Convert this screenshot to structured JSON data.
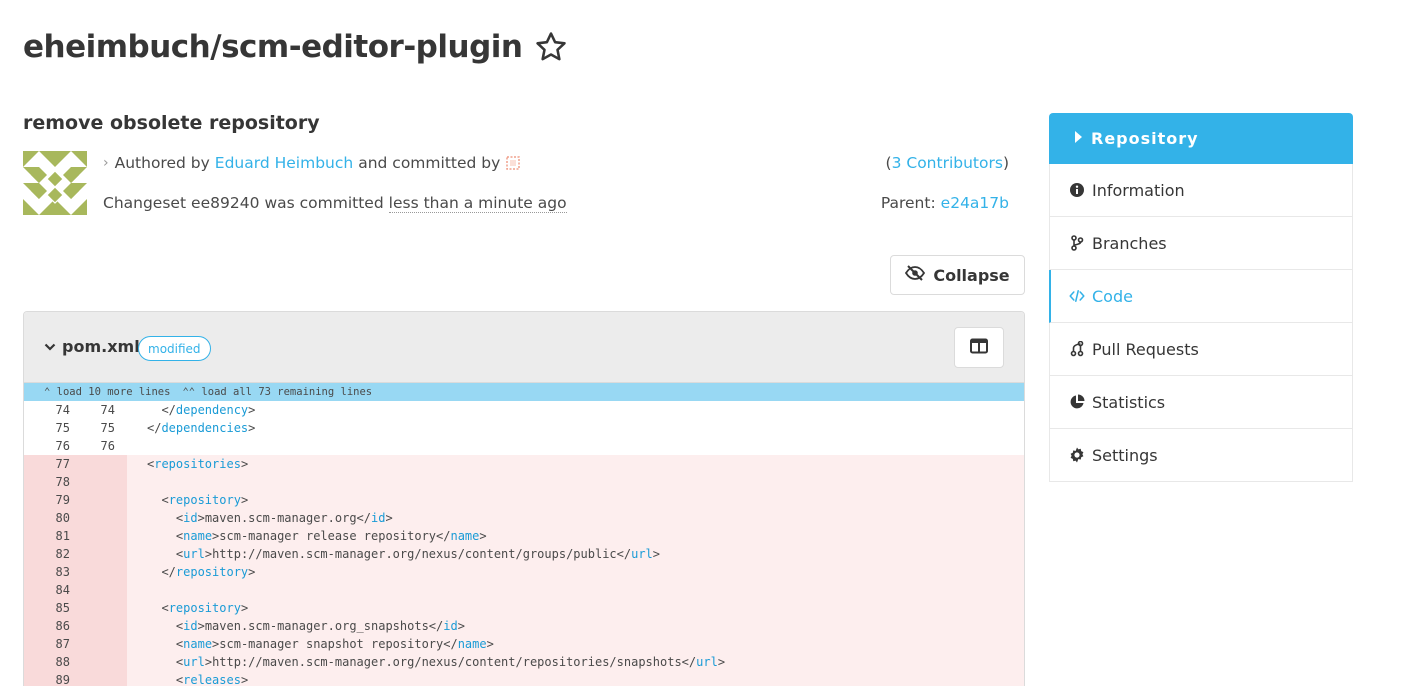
{
  "repo": {
    "title": "eheimbuch/scm-editor-plugin"
  },
  "changeset": {
    "title": "remove obsolete repository",
    "authored_prefix": "Authored by",
    "author": "Eduard Heimbuch",
    "committed_text": "and committed by",
    "line2_prefix": "Changeset",
    "hash": "ee89240",
    "was_committed": "was committed",
    "ago": "less than a minute ago",
    "contributors_open": "(",
    "contributors_link": "3 Contributors",
    "contributors_close": ")",
    "parent_label": "Parent:",
    "parent_hash": "e24a17b"
  },
  "collapse_label": "Collapse",
  "diff": {
    "file_name": "pom.xml",
    "file_tag": "modified",
    "load_more": "load 10 more lines",
    "load_all": "load all 73 remaining lines",
    "lines": [
      {
        "old": "74",
        "new": "74",
        "indent": "  ",
        "open": "</",
        "tag": "dependency",
        "close": ">",
        "rest": "",
        "type": "context"
      },
      {
        "old": "75",
        "new": "75",
        "indent": "",
        "open": "</",
        "tag": "dependencies",
        "close": ">",
        "rest": "",
        "type": "context"
      },
      {
        "old": "76",
        "new": "76",
        "indent": "",
        "open": "",
        "tag": "",
        "close": "",
        "rest": "",
        "type": "context"
      },
      {
        "old": "77",
        "new": "",
        "indent": "",
        "open": "<",
        "tag": "repositories",
        "close": ">",
        "rest": "",
        "type": "del"
      },
      {
        "old": "78",
        "new": "",
        "indent": "",
        "open": "",
        "tag": "",
        "close": "",
        "rest": "",
        "type": "del"
      },
      {
        "old": "79",
        "new": "",
        "indent": "  ",
        "open": "<",
        "tag": "repository",
        "close": ">",
        "rest": "",
        "type": "del"
      },
      {
        "old": "80",
        "new": "",
        "indent": "    ",
        "open": "<",
        "tag": "id",
        "close": ">",
        "rest": "maven.scm-manager.org</",
        "tag2": "id",
        "end": ">",
        "type": "del"
      },
      {
        "old": "81",
        "new": "",
        "indent": "    ",
        "open": "<",
        "tag": "name",
        "close": ">",
        "rest": "scm-manager release repository</",
        "tag2": "name",
        "end": ">",
        "type": "del"
      },
      {
        "old": "82",
        "new": "",
        "indent": "    ",
        "open": "<",
        "tag": "url",
        "close": ">",
        "rest": "http://maven.scm-manager.org/nexus/content/groups/public</",
        "tag2": "url",
        "end": ">",
        "type": "del"
      },
      {
        "old": "83",
        "new": "",
        "indent": "  ",
        "open": "</",
        "tag": "repository",
        "close": ">",
        "rest": "",
        "type": "del"
      },
      {
        "old": "84",
        "new": "",
        "indent": "",
        "open": "",
        "tag": "",
        "close": "",
        "rest": "",
        "type": "del"
      },
      {
        "old": "85",
        "new": "",
        "indent": "  ",
        "open": "<",
        "tag": "repository",
        "close": ">",
        "rest": "",
        "type": "del"
      },
      {
        "old": "86",
        "new": "",
        "indent": "    ",
        "open": "<",
        "tag": "id",
        "close": ">",
        "rest": "maven.scm-manager.org_snapshots</",
        "tag2": "id",
        "end": ">",
        "type": "del"
      },
      {
        "old": "87",
        "new": "",
        "indent": "    ",
        "open": "<",
        "tag": "name",
        "close": ">",
        "rest": "scm-manager snapshot repository</",
        "tag2": "name",
        "end": ">",
        "type": "del"
      },
      {
        "old": "88",
        "new": "",
        "indent": "    ",
        "open": "<",
        "tag": "url",
        "close": ">",
        "rest": "http://maven.scm-manager.org/nexus/content/repositories/snapshots</",
        "tag2": "url",
        "end": ">",
        "type": "del"
      },
      {
        "old": "89",
        "new": "",
        "indent": "    ",
        "open": "<",
        "tag": "releases",
        "close": ">",
        "rest": "",
        "type": "del"
      }
    ]
  },
  "sidebar": {
    "header": "Repository",
    "items": [
      {
        "label": "Information",
        "icon": "info-circle-icon",
        "active": false
      },
      {
        "label": "Branches",
        "icon": "code-branch-icon",
        "active": false
      },
      {
        "label": "Code",
        "icon": "code-icon",
        "active": true
      },
      {
        "label": "Pull Requests",
        "icon": "pull-request-icon",
        "active": false
      },
      {
        "label": "Statistics",
        "icon": "pie-chart-icon",
        "active": false
      },
      {
        "label": "Settings",
        "icon": "gear-icon",
        "active": false
      }
    ]
  },
  "colors": {
    "accent": "#33b2e8",
    "deleted_bg": "#fdeeee",
    "deleted_gutter": "#f9dada",
    "expand_bar": "#98d8f3",
    "avatar_green": "#a8b85c"
  }
}
